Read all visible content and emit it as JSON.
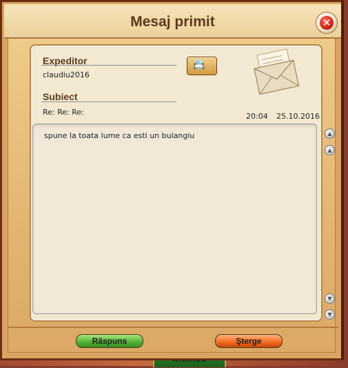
{
  "window": {
    "title": "Mesaj primit"
  },
  "header": {
    "sender_label": "Expeditor",
    "sender_value": "claudiu2016",
    "subject_label": "Subiect",
    "subject_value": "Re: Re: Re:",
    "time": "20:04",
    "date": "25.10.2016"
  },
  "message": {
    "body": "spune la toata lume ca esti un bulangiu"
  },
  "buttons": {
    "reply": "Răspuns",
    "delete": "Şterge",
    "close_bg": "închide"
  },
  "icons": {
    "close": "close-icon",
    "address_book": "address-book-icon",
    "envelope": "envelope-icon",
    "scroll_up": "scroll-up-icon",
    "scroll_down": "scroll-down-icon"
  },
  "colors": {
    "title": "#5a3a1c",
    "reply_button": "#4fb033",
    "delete_button": "#f26a20",
    "close": "#c41b12"
  }
}
